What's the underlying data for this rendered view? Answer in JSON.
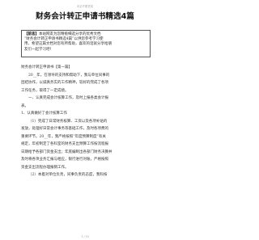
{
  "doc": {
    "watermark": "本站不要复制",
    "title": "财务会计转正申请书精选4篇",
    "intro": {
      "tag": "【前言】",
      "lines": [
        "本站网友为您精挑细选分享的优秀文档",
        "“财务会计转正申请书精选4篇”以供您参考学习使",
        "用，希望这篇文档对您有所帮助，喜欢的话就分享给朋",
        "友们一起学习吧！"
      ]
    },
    "body": [
      "财务会计转正申请书【第一篇】",
      "20__年，在领导的支持和帮助下，我与单位同事的",
      "团结协作，以诚真务实的工作精神，较好的完成了各项",
      "工作任务，取得了一定成绩。",
      "一、认真完成会计核算工作，及时上报各类会计报",
      "表。",
      "1、认真做好了会计核算工作",
      "（1）完成了日常财务核算、工资以及各项补贴的",
      "发放，处理好日常会计事务等基础工作，及时各项费的",
      "重要环节。20__年，我严格按照“年度预算制度”有关",
      "规定，年初制定了各科室的财务支出预算工作按流程报",
      "日期给予各部门资金支出；年底编制出各部门财务决算并",
      "及时将各项业务汇报与相应，银行进行对账，严格按照",
      "资金支出流程办理报销工作。",
      "（2）本着对单位负责，同事负责的态度，我科按"
    ],
    "page_number": "1 / 18"
  }
}
